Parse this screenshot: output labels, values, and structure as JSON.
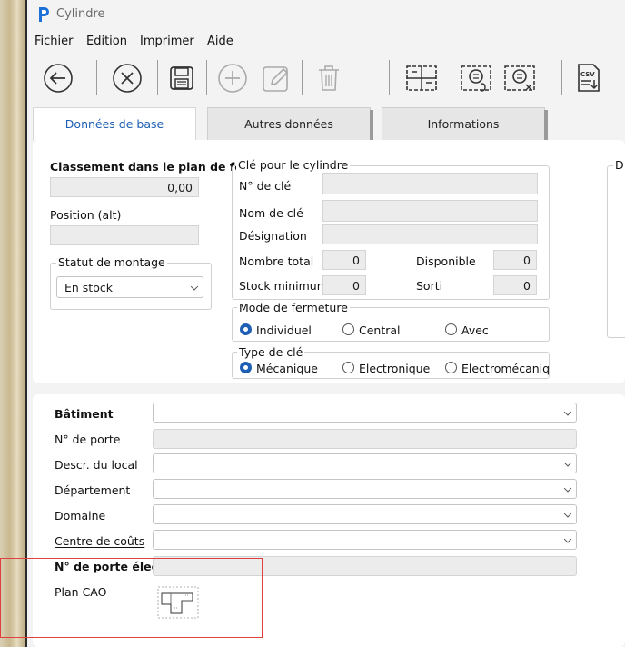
{
  "window": {
    "title": "Cylindre"
  },
  "menu": [
    "Fichier",
    "Edition",
    "Imprimer",
    "Aide"
  ],
  "toolbar": {
    "buttons": [
      "back-arrow-icon",
      "cancel-icon",
      "save-icon",
      "add-icon",
      "edit-icon",
      "delete-icon",
      "layout-icon",
      "key-link-icon",
      "key-unlink-icon",
      "csv-export-icon"
    ],
    "csv_label": "CSV"
  },
  "tabs": [
    "Données de base",
    "Autres données",
    "Informations"
  ],
  "left": {
    "classement_label": "Classement dans le plan de ferm",
    "classement_value": "0,00",
    "position_label": "Position (alt)",
    "position_value": "",
    "statut_legend": "Statut de montage",
    "statut_value": "En stock"
  },
  "cle": {
    "legend": "Clé pour le cylindre",
    "no_cle_label": "N° de clé",
    "nom_cle_label": "Nom de clé",
    "designation_label": "Désignation",
    "nombre_total_label": "Nombre total",
    "nombre_total_value": "0",
    "disponible_label": "Disponible",
    "disponible_value": "0",
    "stock_min_label": "Stock minimum",
    "stock_min_value": "0",
    "sorti_label": "Sorti",
    "sorti_value": "0"
  },
  "mode_fermeture": {
    "legend": "Mode de fermeture",
    "options": [
      "Individuel",
      "Central",
      "Avec"
    ],
    "selected": 0
  },
  "type_cle": {
    "legend": "Type de clé",
    "options": [
      "Mécanique",
      "Electronique",
      "Electromécaniqu"
    ],
    "selected": 0
  },
  "right_group_legend": "D",
  "bottom": {
    "batiment": "Bâtiment",
    "no_porte": "N° de porte",
    "descr_local": "Descr. du local",
    "departement": "Département",
    "domaine": "Domaine",
    "centre_couts": "Centre de coûts",
    "no_porte_elec": "N° de porte élec.",
    "plan_cao": "Plan CAO"
  },
  "colors": {
    "accent": "#1e5fb4",
    "highlight_box": "#e04040"
  }
}
